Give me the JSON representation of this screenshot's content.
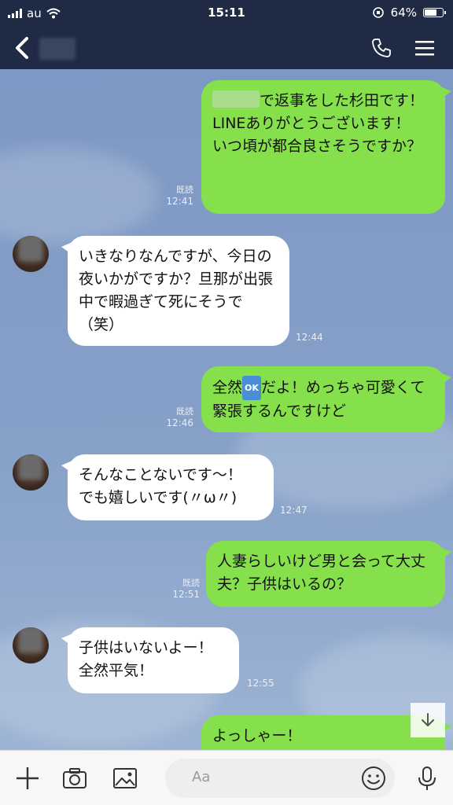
{
  "status_bar": {
    "carrier": "au",
    "time": "15:11",
    "battery": "64%"
  },
  "header": {
    "contact_name_hidden": true
  },
  "messages": [
    {
      "side": "out",
      "text_after_redaction": "で返事をした杉田です！LINEありがとうございます！\nいつ頃が都合良さそうですか？",
      "read": "既読",
      "time": "12:41"
    },
    {
      "side": "in",
      "text": "いきなりなんですが、今日の夜いかがですか？旦那が出張中で暇過ぎて死にそうで（笑）",
      "time": "12:44"
    },
    {
      "side": "out",
      "text_before": "全然",
      "badge": "OK",
      "text_after": "だよ！めっちゃ可愛くて緊張するんですけど",
      "read": "既読",
      "time": "12:46"
    },
    {
      "side": "in",
      "text": "そんなことないです〜！\nでも嬉しいです(〃ω〃)",
      "time": "12:47"
    },
    {
      "side": "out",
      "text": "人妻らしいけど男と会って大丈夫？子供はいるの？",
      "read": "既読",
      "time": "12:51"
    },
    {
      "side": "in",
      "text": "子供はいないよー！\n全然平気！",
      "time": "12:55"
    },
    {
      "side": "out",
      "text": "よっしゃー！"
    }
  ],
  "input": {
    "placeholder": "Aa"
  },
  "colors": {
    "header_bg": "#1f2b45",
    "outgoing_bubble": "#85e04c",
    "incoming_bubble": "#ffffff",
    "chat_bg": "#7f9ac4"
  }
}
